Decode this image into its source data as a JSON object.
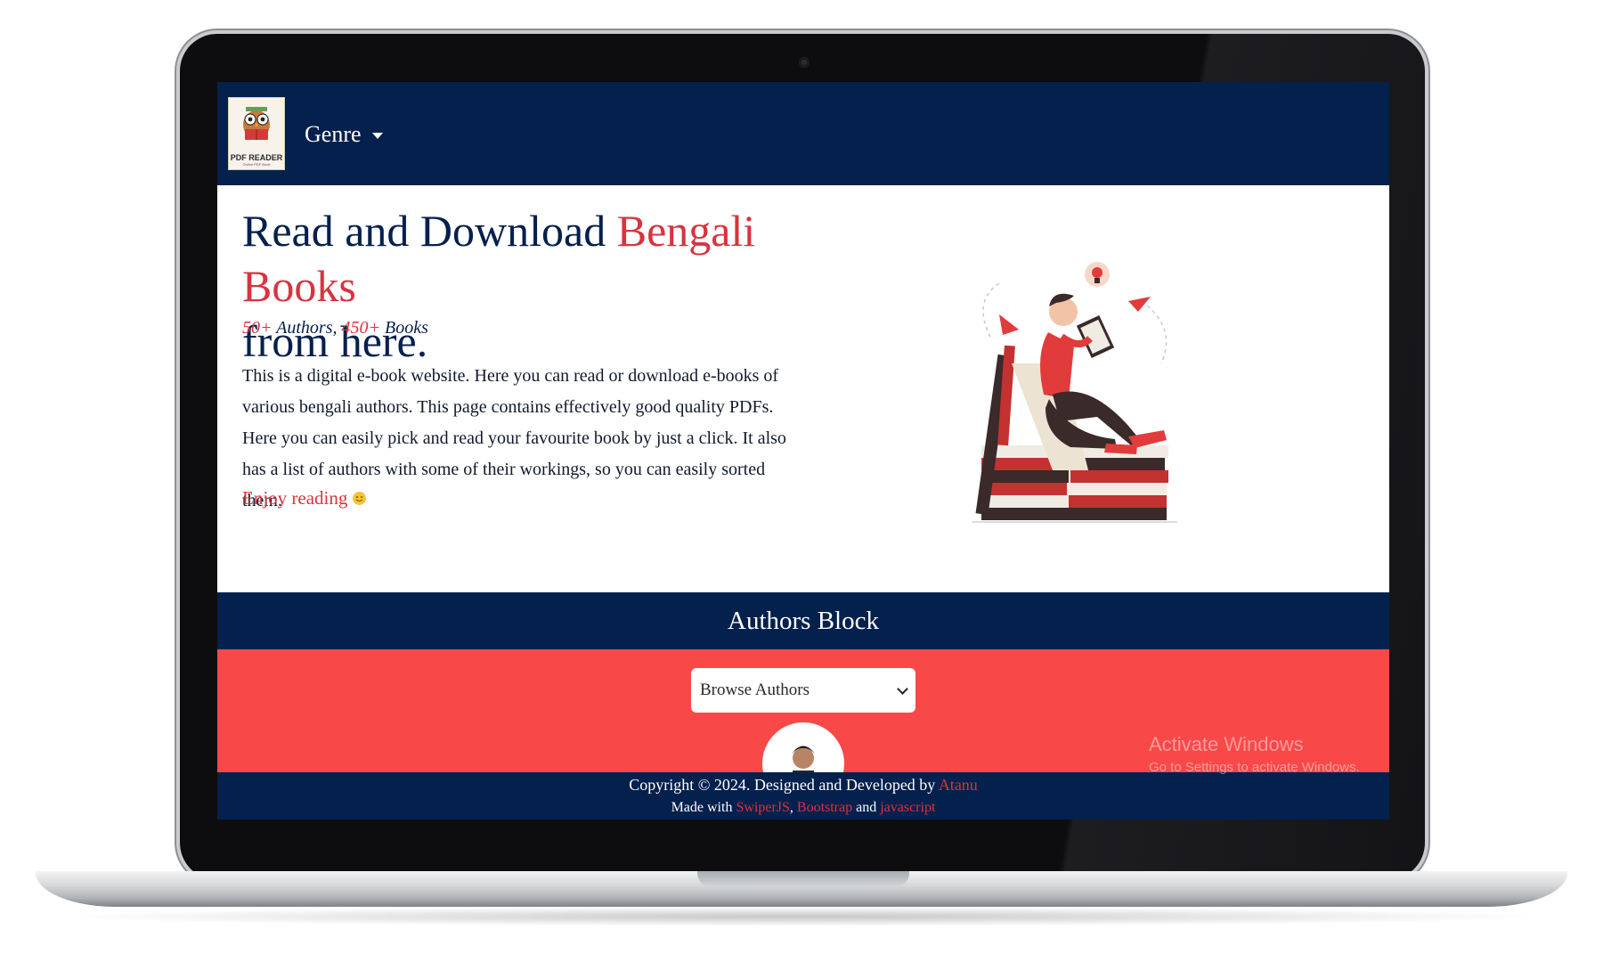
{
  "navbar": {
    "logo_text": "PDF READER",
    "logo_subtext": "Online PDF Book",
    "genre_label": "Genre"
  },
  "hero": {
    "title_part1": "Read and Download ",
    "title_accent": "Bengali Books",
    "title_part2": "from here.",
    "authors_count": "50+",
    "authors_label": " Authors, ",
    "books_count": "450+",
    "books_label": " Books",
    "description": "This is a digital e-book website. Here you can read or download e-books of various bengali authors. This page contains effectively good quality PDFs. Here you can easily pick and read your favourite book by just a click. It also has a list of authors with some of their workings, so you can easily sorted them.",
    "enjoy": "Enjoy reading"
  },
  "authors_block": {
    "heading": "Authors Block",
    "select_value": "Browse Authors"
  },
  "footer": {
    "copyright": "Copyright © 2024. Designed and Developed by ",
    "developer": "Atanu",
    "made_with": "Made with ",
    "tech1": "SwiperJS",
    "sep1": ", ",
    "tech2": "Bootstrap",
    "sep2": " and ",
    "tech3": "javascript"
  },
  "watermark": {
    "line1": "Activate Windows",
    "line2": "Go to Settings to activate Windows."
  },
  "colors": {
    "navy": "#04204d",
    "accent_red": "#d9333f",
    "authors_bg": "#f94848"
  }
}
